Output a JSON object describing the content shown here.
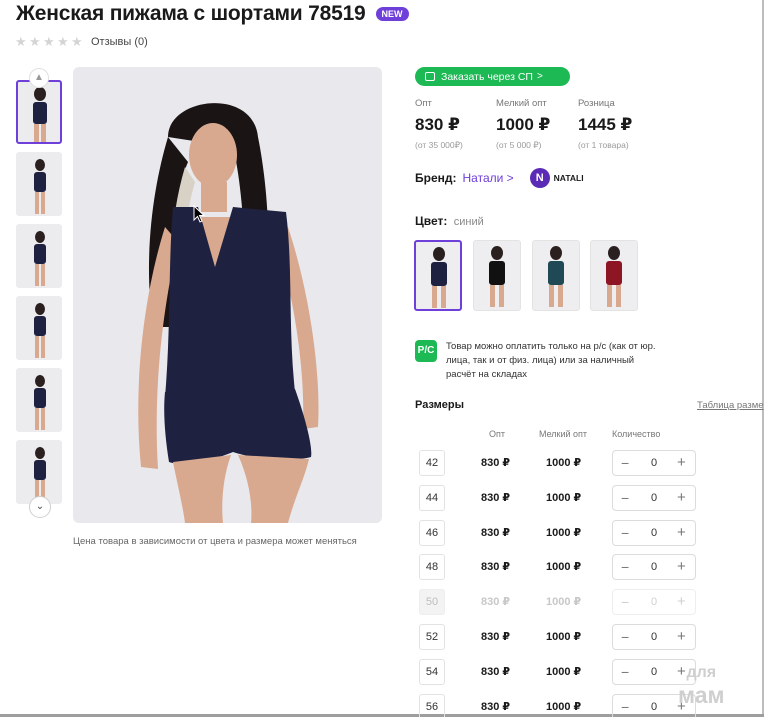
{
  "product": {
    "title": "Женская пижама с шортами 78519",
    "badge": "NEW",
    "reviews": "Отзывы (0)",
    "image_caption": "Цена товара в зависимости от цвета и размера может меняться"
  },
  "order_button": {
    "label": "Заказать через СП",
    "chevron": ">"
  },
  "prices": [
    {
      "label": "Опт",
      "value": "830 ₽",
      "note": "(от 35 000₽)"
    },
    {
      "label": "Мелкий опт",
      "value": "1000 ₽",
      "note": "(от 5 000 ₽)"
    },
    {
      "label": "Розница",
      "value": "1445 ₽",
      "note": "(от 1 товара)"
    }
  ],
  "brand": {
    "label": "Бренд:",
    "link": "Натали >",
    "logo_letter": "N",
    "logo_name": "NATALI"
  },
  "color": {
    "label": "Цвет:",
    "value": "синий",
    "swatches": [
      "#1e2140",
      "#111111",
      "#1f4a55",
      "#8e1624"
    ]
  },
  "payment": {
    "icon_text": "Р/С",
    "text": "Товар можно оплатить только на р/с (как от юр. лица, так и от физ. лица) или за наличный расчёт на складах"
  },
  "sizes": {
    "title": "Размеры",
    "table_link": "Таблица разме",
    "headers": [
      "Опт",
      "Мелкий опт",
      "Количество"
    ],
    "rows": [
      {
        "size": "42",
        "opt": "830 ₽",
        "small": "1000 ₽",
        "qty": "0",
        "disabled": false
      },
      {
        "size": "44",
        "opt": "830 ₽",
        "small": "1000 ₽",
        "qty": "0",
        "disabled": false
      },
      {
        "size": "46",
        "opt": "830 ₽",
        "small": "1000 ₽",
        "qty": "0",
        "disabled": false
      },
      {
        "size": "48",
        "opt": "830 ₽",
        "small": "1000 ₽",
        "qty": "0",
        "disabled": false
      },
      {
        "size": "50",
        "opt": "830 ₽",
        "small": "1000 ₽",
        "qty": "0",
        "disabled": true
      },
      {
        "size": "52",
        "opt": "830 ₽",
        "small": "1000 ₽",
        "qty": "0",
        "disabled": false
      },
      {
        "size": "54",
        "opt": "830 ₽",
        "small": "1000 ₽",
        "qty": "0",
        "disabled": false
      },
      {
        "size": "56",
        "opt": "830 ₽",
        "small": "1000 ₽",
        "qty": "0",
        "disabled": false
      }
    ]
  },
  "watermark": {
    "top": "для",
    "bottom": "мам"
  },
  "theme": {
    "accent": "#6e3fd9",
    "green": "#1db954",
    "garment": "#1e2140"
  }
}
